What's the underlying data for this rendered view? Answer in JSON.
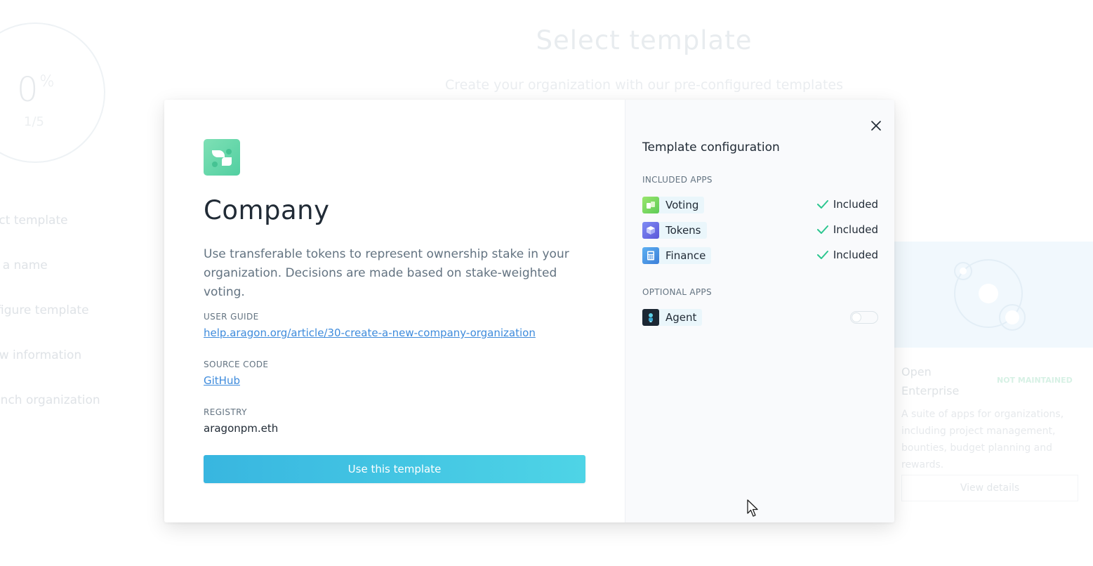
{
  "background": {
    "progress": {
      "percent": "0",
      "percent_sign": "%",
      "count": "1/5"
    },
    "steps": [
      "Select template",
      "Claim a name",
      "Configure template",
      "Review information",
      "Launch organization"
    ],
    "title": "Select template",
    "subtitle": "Create your organization with our pre-configured templates",
    "card": {
      "name": "Open Enterprise",
      "badge": "NOT MAINTAINED",
      "description": "A suite of apps for organizations, including project management, bounties, budget planning and rewards.",
      "button": "View details"
    }
  },
  "modal": {
    "template": {
      "title": "Company",
      "description": "Use transferable tokens to represent ownership stake in your organization. Decisions are made based on stake-weighted voting.",
      "user_guide_label": "USER GUIDE",
      "user_guide_link": "help.aragon.org/article/30-create-a-new-company-organization",
      "source_code_label": "SOURCE CODE",
      "source_code_link": "GitHub",
      "registry_label": "REGISTRY",
      "registry_value": "aragonpm.eth",
      "use_button": "Use this template",
      "icon": "company-template-icon",
      "accent_color": "#5fd6a8"
    },
    "config": {
      "title": "Template configuration",
      "included_label": "INCLUDED APPS",
      "optional_label": "OPTIONAL APPS",
      "included_apps": [
        {
          "name": "Voting",
          "status": "Included",
          "icon": "voting-app-icon"
        },
        {
          "name": "Tokens",
          "status": "Included",
          "icon": "tokens-app-icon"
        },
        {
          "name": "Finance",
          "status": "Included",
          "icon": "finance-app-icon"
        }
      ],
      "optional_apps": [
        {
          "name": "Agent",
          "enabled": false,
          "icon": "agent-app-icon"
        }
      ]
    }
  }
}
